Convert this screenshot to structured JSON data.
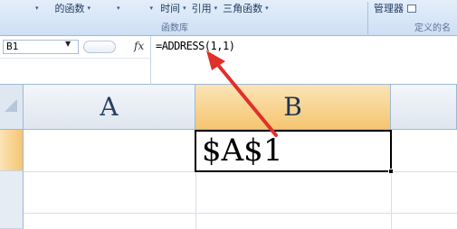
{
  "ribbon": {
    "row_items": [
      {
        "label": "▾"
      },
      {
        "label": "的函数"
      },
      {
        "label": "▾"
      },
      {
        "label": "▾"
      },
      {
        "label": "时间"
      },
      {
        "label": "引用"
      },
      {
        "label": "三角函数"
      }
    ],
    "function_library_group": "函数库",
    "name_manager": "管理器",
    "defined_names_group": "定义的名"
  },
  "formula_bar": {
    "name_box": "B1",
    "fx_symbol": "fx",
    "formula": "=ADDRESS(1,1)"
  },
  "grid": {
    "columns": [
      "A",
      "B"
    ],
    "selected_cell_value": "$A$1"
  },
  "colors": {
    "selected_header": "#f5c571",
    "annotation_arrow": "#e0302a"
  }
}
